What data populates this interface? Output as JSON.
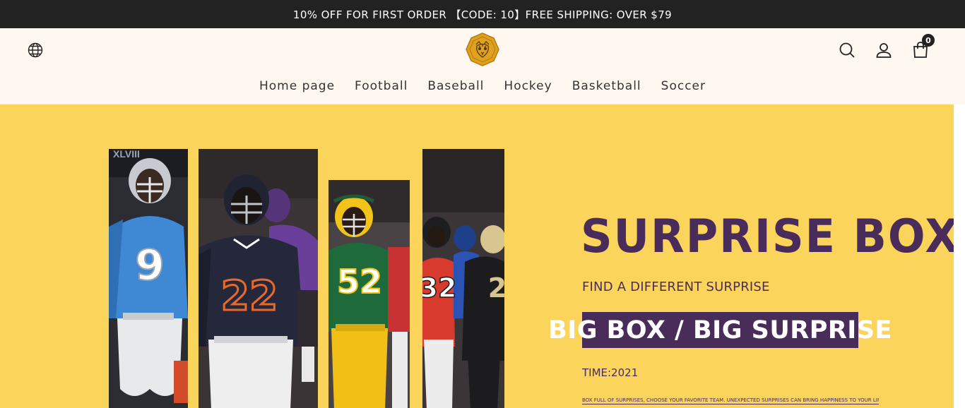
{
  "announcement": "10% OFF FOR FIRST ORDER 【CODE: 10】FREE SHIPPING: OVER $79",
  "header": {
    "icons": [
      "globe-icon",
      "tiger-logo",
      "search-icon",
      "user-icon",
      "cart-icon"
    ],
    "cart_count": "0"
  },
  "nav": {
    "items": [
      {
        "label": "Home page"
      },
      {
        "label": "Football"
      },
      {
        "label": "Baseball"
      },
      {
        "label": "Hockey"
      },
      {
        "label": "Basketball"
      },
      {
        "label": "Soccer"
      }
    ]
  },
  "hero": {
    "title": "SURPRISE BOX",
    "subtitle": "FIND A DIFFERENT SURPRISE",
    "badge": "BIG BOX / BIG SURPRISE",
    "time": "TIME:2021",
    "description": "BOX FULL OF SURPRISES, CHOOSE YOUR FAVORITE TEAM. UNEXPECTED SURPRISES CAN BRING HAPPINESS TO YOUR LIFE",
    "jersey_numbers": [
      "9",
      "22",
      "52",
      "32"
    ]
  },
  "colors": {
    "announcement_bg": "#222222",
    "header_bg": "#fff8f1",
    "hero_bg": "#fad45b",
    "accent_purple": "#4a2c5a",
    "logo_gold": "#e0a21c"
  }
}
